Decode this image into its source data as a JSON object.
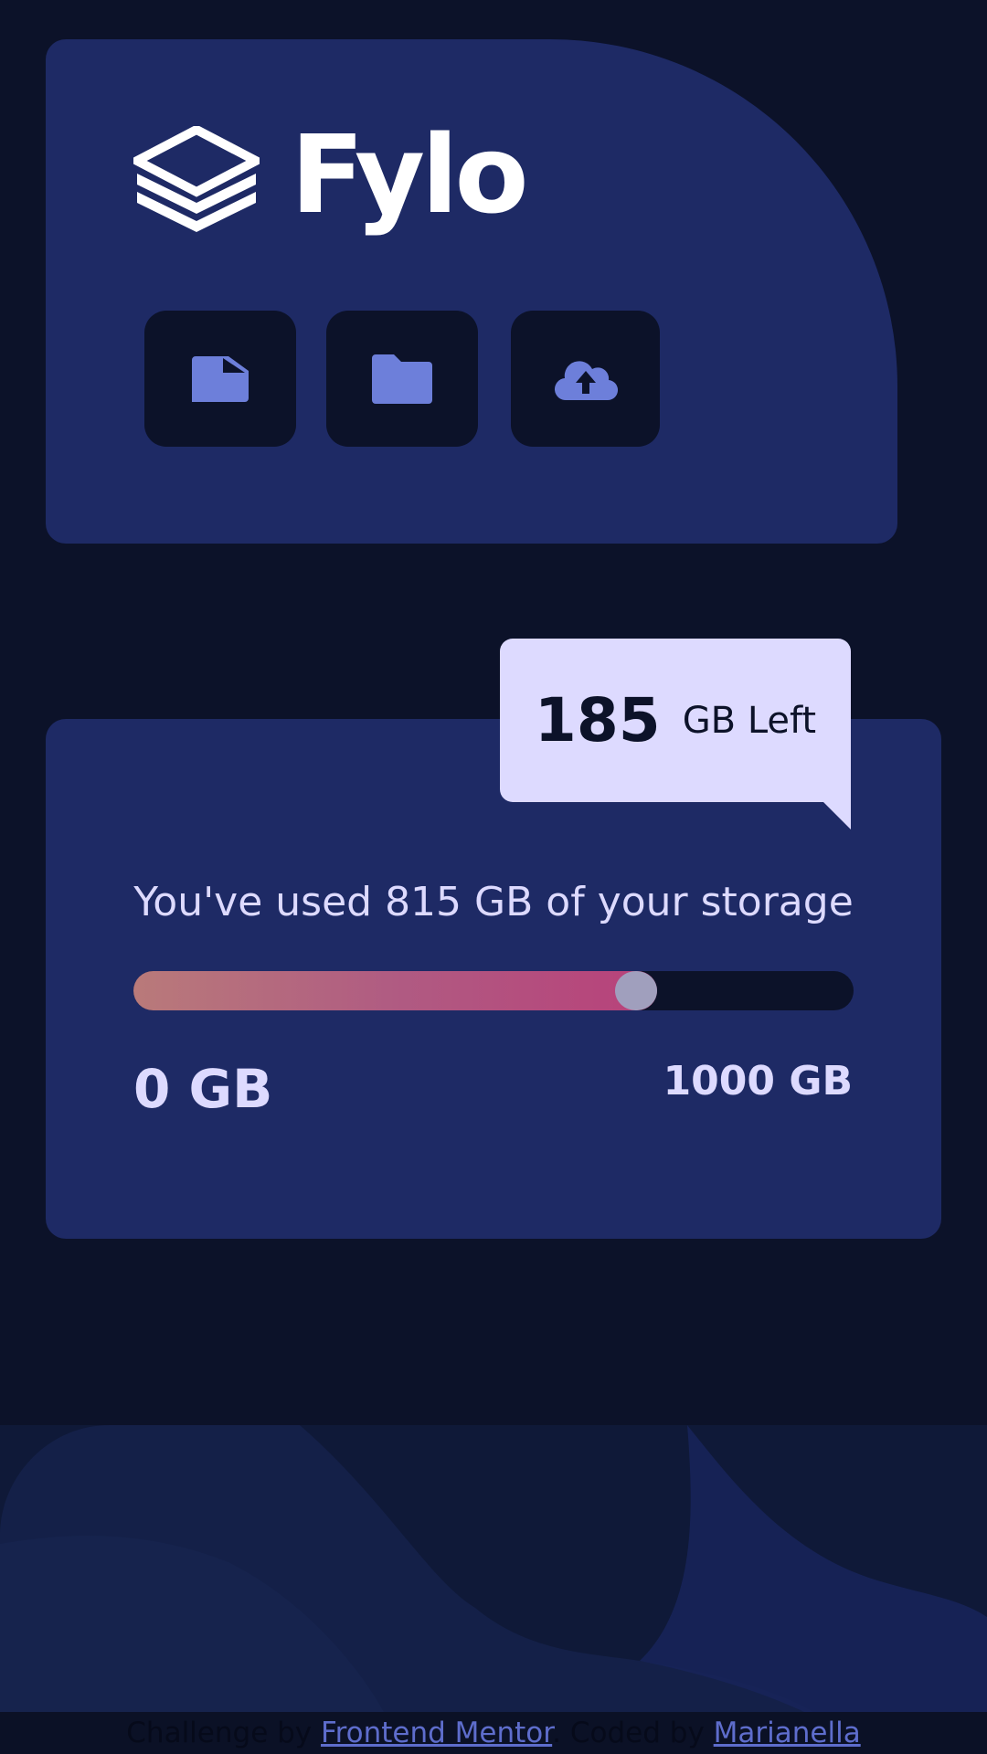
{
  "brand": {
    "name": "Fylo",
    "logo_icon": "layers-icon"
  },
  "toolbar": {
    "buttons": [
      {
        "icon": "document-icon"
      },
      {
        "icon": "folder-icon"
      },
      {
        "icon": "cloud-upload-icon"
      }
    ]
  },
  "storage": {
    "remaining_value": "185",
    "remaining_unit": "GB Left",
    "usage_text": "You've used 815 GB of your storage",
    "range_min": "0 GB",
    "range_max": "1000 GB",
    "used_fraction": 0.815
  },
  "footer": {
    "challenge_prefix": "Challenge by",
    "challenge_link": "Frontend Mentor",
    "coded_prefix": ". Coded by",
    "author_link": "Marianella"
  },
  "colors": {
    "background": "#0c1229",
    "card": "#1e2a65",
    "accent_icon": "#6d7fda",
    "bubble": "#dddaff",
    "gradient_start": "#b97a7a",
    "gradient_end": "#b8417a"
  }
}
